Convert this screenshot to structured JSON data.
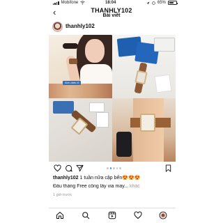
{
  "status_bar": {
    "carrier": "Mobifone",
    "time": "18:04",
    "battery": "65%",
    "battery_level": 0.65
  },
  "header": {
    "title": "THANHLY102",
    "subtitle": "Bài viết"
  },
  "post": {
    "username": "thanhly102",
    "image_tag": "Kinh chiếu rõ",
    "carousel": {
      "count": 5,
      "active_index": 1
    },
    "caption_user": "thanhly102",
    "caption_text": " 1 tuần nữa cập bến😍😍😍",
    "caption_line2": "Đầu tháng Free công lấy via may...",
    "more_label": " khác",
    "time_ago": "1 giờ trước"
  },
  "icons": {
    "back": "back-arrow-icon",
    "like": "heart-icon",
    "comment": "comment-icon",
    "share": "send-icon",
    "save": "bookmark-icon",
    "home": "home-icon",
    "search": "search-icon",
    "reels": "reels-icon",
    "activity": "heart-icon",
    "profile": "profile-icon"
  }
}
